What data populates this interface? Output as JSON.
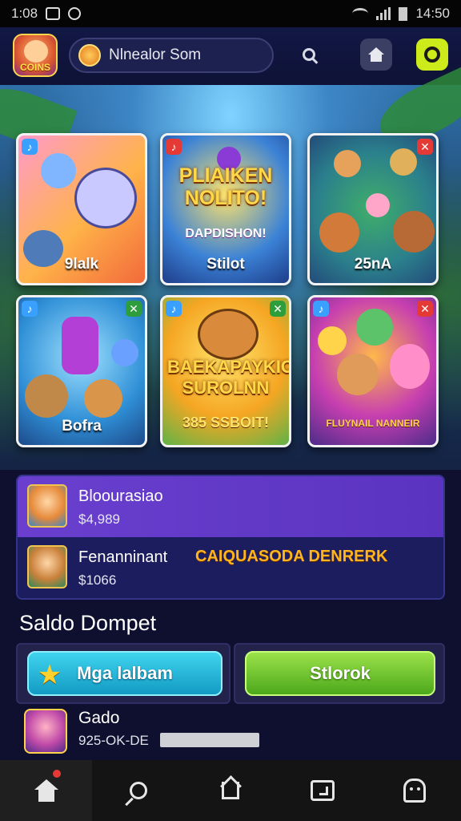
{
  "status_bar": {
    "time_left": "1:08",
    "time_right": "14:50"
  },
  "header": {
    "logo_text": "COINS",
    "search_text": "Nlnealor Som",
    "icons": [
      "search-icon",
      "home-icon",
      "game-icon"
    ],
    "accent_color": "#cdea1b"
  },
  "games": [
    {
      "label": "9lalk",
      "title": "",
      "subtitle": ""
    },
    {
      "label": "Stilot",
      "title": "PLIAIKEN NOLITO!",
      "subtitle": "DAPDISHON!"
    },
    {
      "label": "25nA",
      "title": "",
      "subtitle": ""
    },
    {
      "label": "Bofra",
      "title": "",
      "subtitle": ""
    },
    {
      "label": "",
      "title": "BAEKAPAYKIO SUROLNN",
      "subtitle": "385 SSBOIT!"
    },
    {
      "label": "",
      "title": "",
      "subtitle": "FLUYNAIL NANNEIR"
    }
  ],
  "list": [
    {
      "name": "Bloourasiao",
      "value": "$4,989",
      "tag": ""
    },
    {
      "name": "Fenanninant",
      "value": "$1066",
      "tag": "CAIQUASODA DENRERK"
    }
  ],
  "wallet": {
    "title": "Saldo Dompet",
    "primary_button": "Mga lalbam",
    "secondary_button": "Stlorok",
    "entry_name": "Gado",
    "entry_value": "925-OK-DE"
  },
  "bottom_nav": [
    "home-icon",
    "search-icon",
    "home-outline-icon",
    "screen-icon",
    "ghost-icon"
  ]
}
